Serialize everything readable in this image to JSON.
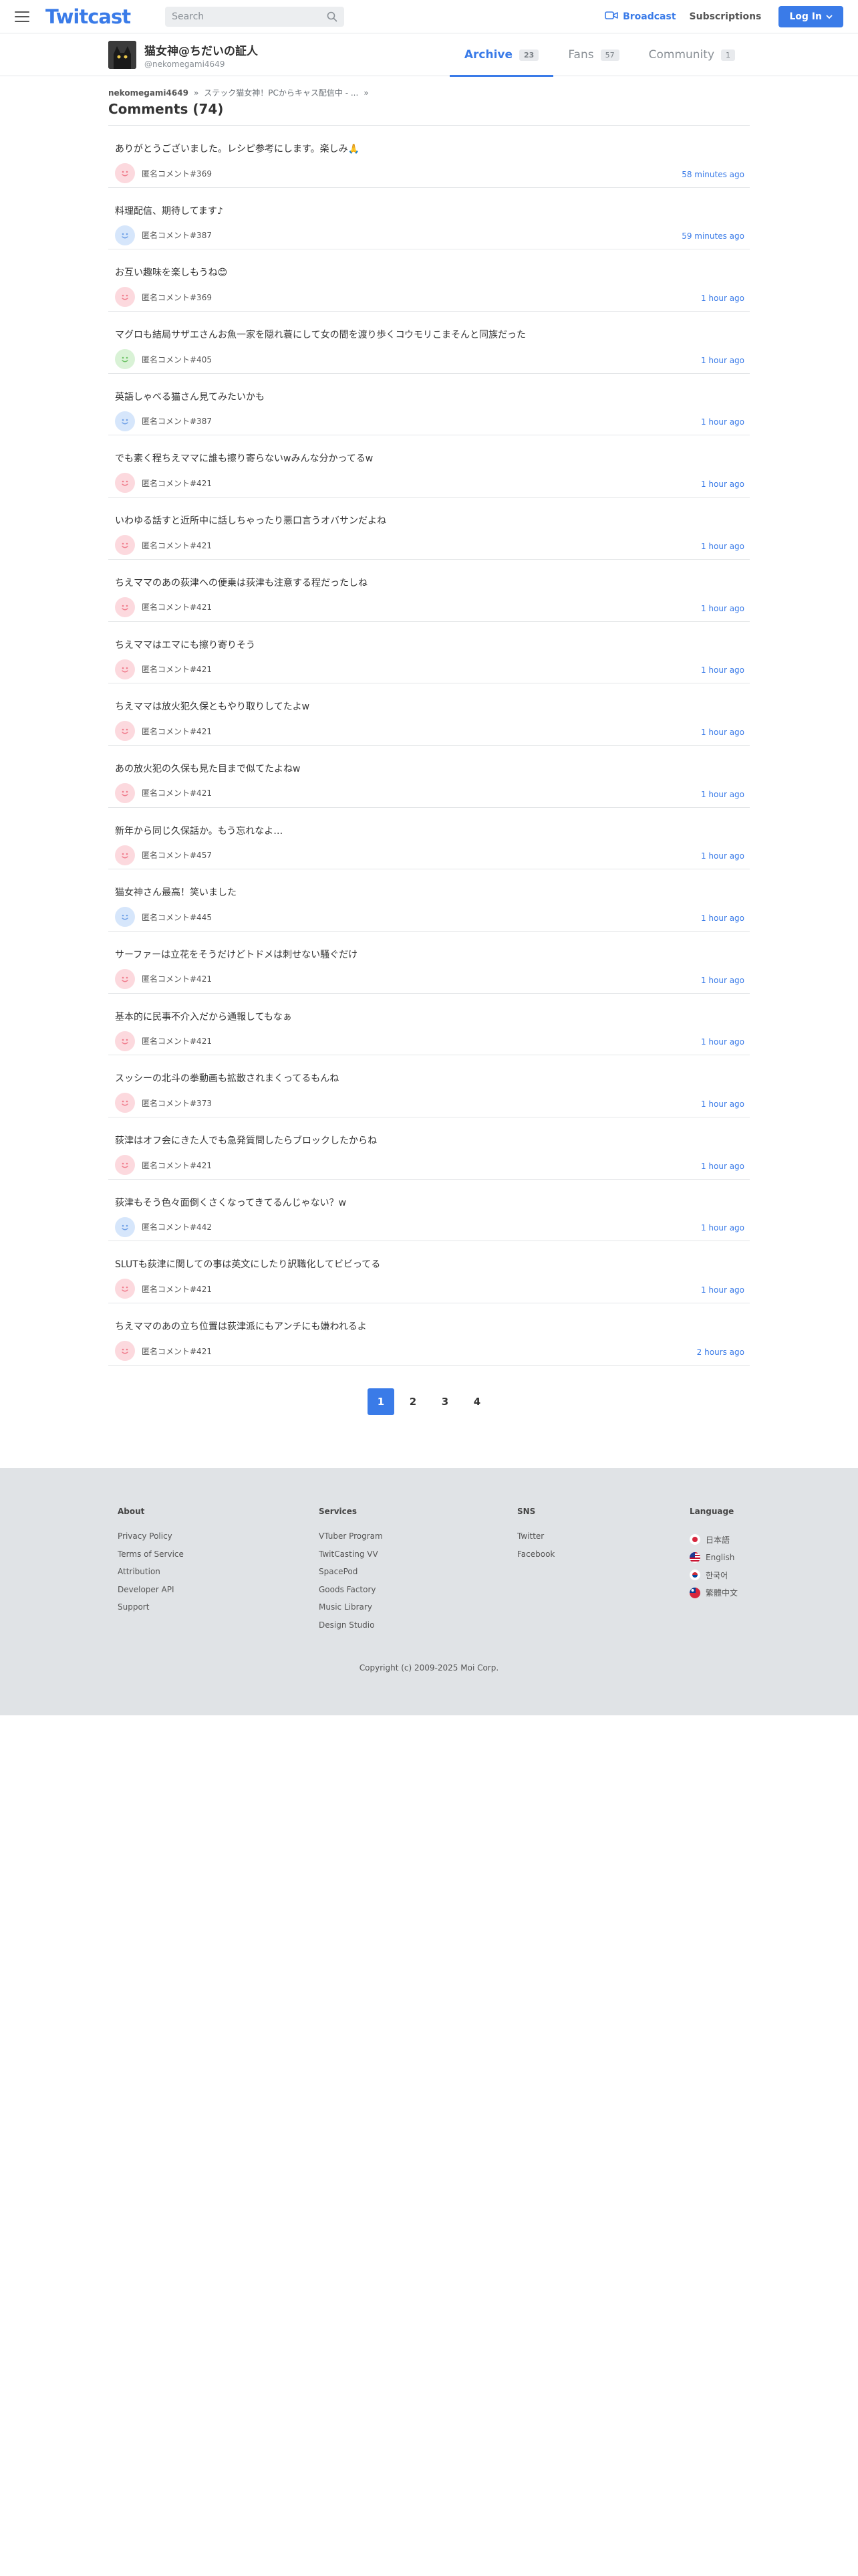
{
  "header": {
    "logo": "Twitcast",
    "search_placeholder": "Search",
    "broadcast_label": "Broadcast",
    "subscriptions_label": "Subscriptions",
    "login_label": "Log In",
    "accent_color": "#3a7be8"
  },
  "profile": {
    "name": "猫女神@ちだいの証人",
    "handle": "@nekomegami4649",
    "tabs": [
      {
        "label": "Archive",
        "count": "23",
        "active": true
      },
      {
        "label": "Fans",
        "count": "57",
        "active": false
      },
      {
        "label": "Community",
        "count": "1",
        "active": false
      }
    ]
  },
  "breadcrumb": {
    "user": "nekomegami4649",
    "separator": "»",
    "item": "ステック猫女神！PCからキャス配信中 - ...",
    "trailing": "»"
  },
  "page_title": "Comments (74)",
  "comments": [
    {
      "text": "ありがとうございました。レシピ参考にします。楽しみ🙏",
      "user": "匿名コメント#369",
      "time": "58 minutes ago",
      "avatar": "pink"
    },
    {
      "text": "料理配信、期待してます♪",
      "user": "匿名コメント#387",
      "time": "59 minutes ago",
      "avatar": "blue"
    },
    {
      "text": "お互い趣味を楽しもうね😊",
      "user": "匿名コメント#369",
      "time": "1 hour ago",
      "avatar": "pink"
    },
    {
      "text": "マグロも結局サザエさんお魚一家を隠れ蓑にして女の間を渡り歩くコウモリこまそんと同族だった",
      "user": "匿名コメント#405",
      "time": "1 hour ago",
      "avatar": "green"
    },
    {
      "text": "英語しゃべる猫さん見てみたいかも",
      "user": "匿名コメント#387",
      "time": "1 hour ago",
      "avatar": "blue"
    },
    {
      "text": "でも素く程ちえママに誰も擦り寄らないwみんな分かってるw",
      "user": "匿名コメント#421",
      "time": "1 hour ago",
      "avatar": "pink"
    },
    {
      "text": "いわゆる話すと近所中に話しちゃったり悪口言うオバサンだよね",
      "user": "匿名コメント#421",
      "time": "1 hour ago",
      "avatar": "pink"
    },
    {
      "text": "ちえママのあの荻津への便乗は荻津も注意する程だったしね",
      "user": "匿名コメント#421",
      "time": "1 hour ago",
      "avatar": "pink"
    },
    {
      "text": "ちえママはエマにも擦り寄りそう",
      "user": "匿名コメント#421",
      "time": "1 hour ago",
      "avatar": "pink"
    },
    {
      "text": "ちえママは放火犯久保ともやり取りしてたよw",
      "user": "匿名コメント#421",
      "time": "1 hour ago",
      "avatar": "pink"
    },
    {
      "text": "あの放火犯の久保も見た目まで似てたよねw",
      "user": "匿名コメント#421",
      "time": "1 hour ago",
      "avatar": "pink"
    },
    {
      "text": "新年から同じ久保話か。もう忘れなよ…",
      "user": "匿名コメント#457",
      "time": "1 hour ago",
      "avatar": "pink"
    },
    {
      "text": "猫女神さん最高！笑いました",
      "user": "匿名コメント#445",
      "time": "1 hour ago",
      "avatar": "blue"
    },
    {
      "text": "サーファーは立花をそうだけどトドメは刺せない騒ぐだけ",
      "user": "匿名コメント#421",
      "time": "1 hour ago",
      "avatar": "pink"
    },
    {
      "text": "基本的に民事不介入だから通報してもなぁ",
      "user": "匿名コメント#421",
      "time": "1 hour ago",
      "avatar": "pink"
    },
    {
      "text": "スッシーの北斗の拳動画も拡散されまくってるもんね",
      "user": "匿名コメント#373",
      "time": "1 hour ago",
      "avatar": "pink"
    },
    {
      "text": "荻津はオフ会にきた人でも急発質問したらブロックしたからね",
      "user": "匿名コメント#421",
      "time": "1 hour ago",
      "avatar": "pink"
    },
    {
      "text": "荻津もそう色々面倒くさくなってきてるんじゃない？w",
      "user": "匿名コメント#442",
      "time": "1 hour ago",
      "avatar": "blue"
    },
    {
      "text": "SLUTも荻津に関しての事は英文にしたり訳職化してビビってる",
      "user": "匿名コメント#421",
      "time": "1 hour ago",
      "avatar": "pink"
    },
    {
      "text": "ちえママのあの立ち位置は荻津派にもアンチにも嫌われるよ",
      "user": "匿名コメント#421",
      "time": "2 hours ago",
      "avatar": "pink"
    }
  ],
  "avatar_colors": {
    "pink": {
      "bg": "#fcd9de",
      "fg": "#f07c8c"
    },
    "blue": {
      "bg": "#d6e6fb",
      "fg": "#6fa0e6"
    },
    "green": {
      "bg": "#d9f2d6",
      "fg": "#6cc264"
    }
  },
  "pagination": {
    "pages": [
      "1",
      "2",
      "3",
      "4"
    ],
    "current": "1"
  },
  "footer": {
    "about": {
      "title": "About",
      "links": [
        "Privacy Policy",
        "Terms of Service",
        "Attribution",
        "Developer API",
        "Support"
      ]
    },
    "services": {
      "title": "Services",
      "links": [
        "VTuber Program",
        "TwitCasting VV",
        "SpacePod",
        "Goods Factory",
        "Music Library",
        "Design Studio"
      ]
    },
    "sns": {
      "title": "SNS",
      "links": [
        "Twitter",
        "Facebook"
      ]
    },
    "language": {
      "title": "Language",
      "items": [
        {
          "label": "日本語",
          "flag": "jp-flag-icon"
        },
        {
          "label": "English",
          "flag": "us-flag-icon"
        },
        {
          "label": "한국어",
          "flag": "kr-flag-icon"
        },
        {
          "label": "繁體中文",
          "flag": "tw-flag-icon"
        }
      ]
    },
    "copyright": "Copyright (c) 2009-2025 Moi Corp."
  }
}
